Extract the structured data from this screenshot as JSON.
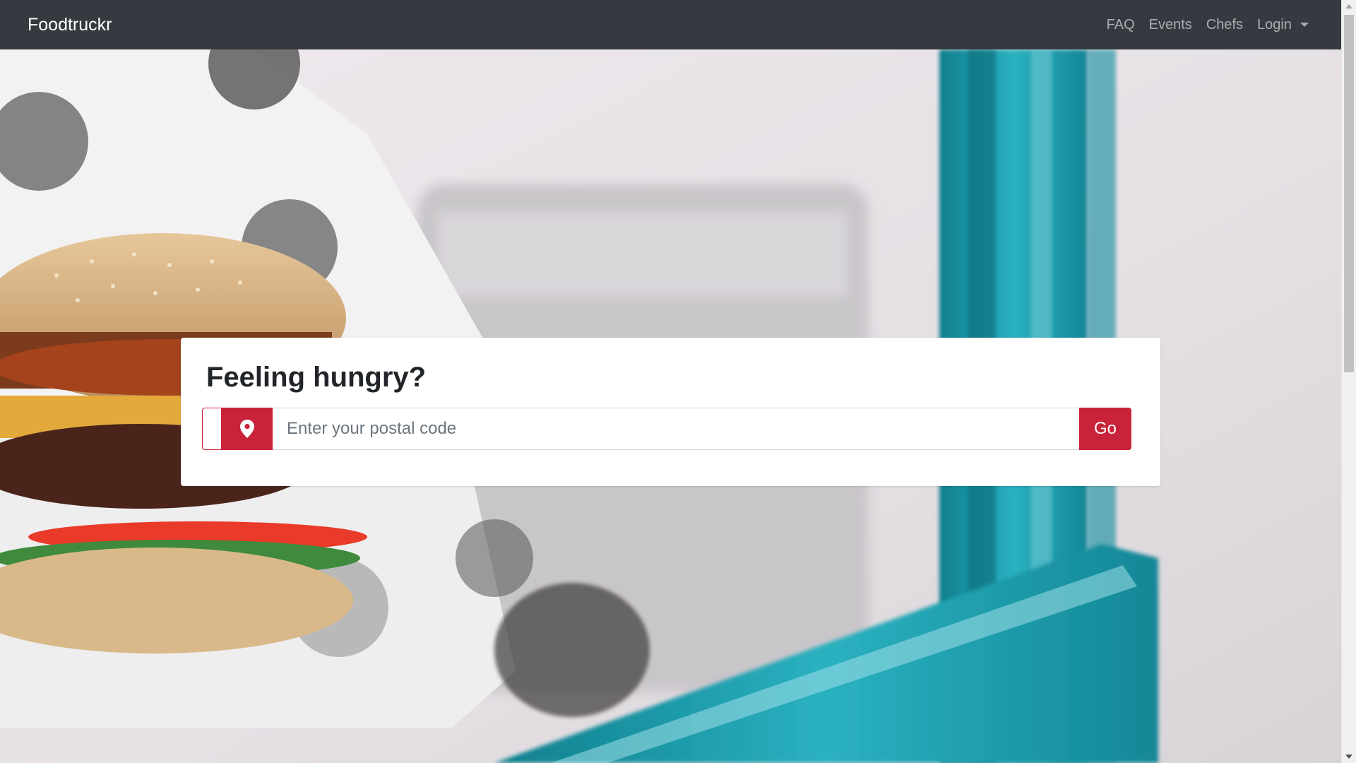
{
  "navbar": {
    "brand": "Foodtruckr",
    "links": [
      {
        "label": "FAQ"
      },
      {
        "label": "Events"
      },
      {
        "label": "Chefs"
      },
      {
        "label": "Login"
      }
    ]
  },
  "hero": {
    "background": "burger-in-food-truck-photo"
  },
  "search_card": {
    "title": "Feeling hungry?",
    "input": {
      "value": "",
      "placeholder": "Enter your postal code",
      "icon": "map-pin-icon"
    },
    "go_label": "Go"
  },
  "colors": {
    "navbar": "#343a40",
    "accent": "#c8233a",
    "card": "#ffffff"
  }
}
